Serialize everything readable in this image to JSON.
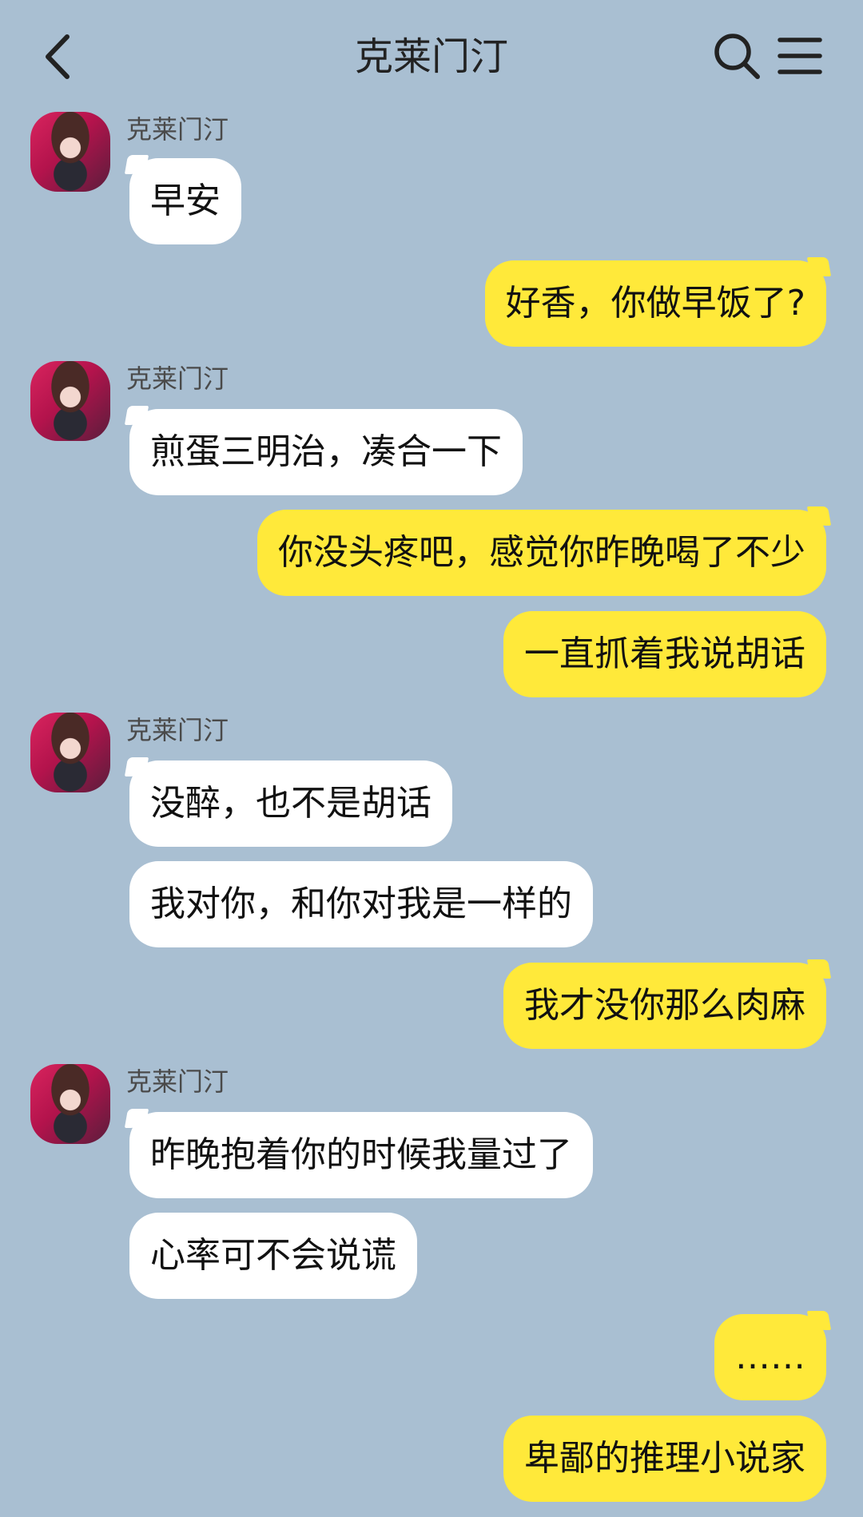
{
  "header": {
    "title": "克莱门汀"
  },
  "messages": [
    {
      "side": "left",
      "sender": "克莱门汀",
      "text": "早安"
    },
    {
      "side": "right",
      "text": "好香，你做早饭了?"
    },
    {
      "side": "left",
      "sender": "克莱门汀",
      "text": "煎蛋三明治，凑合一下"
    },
    {
      "side": "right",
      "text": "你没头疼吧，感觉你昨晚喝了不少"
    },
    {
      "side": "right",
      "text": "一直抓着我说胡话"
    },
    {
      "side": "left",
      "sender": "克莱门汀",
      "text": "没醉，也不是胡话"
    },
    {
      "side": "left",
      "text": "我对你，和你对我是一样的"
    },
    {
      "side": "right",
      "text": "我才没你那么肉麻"
    },
    {
      "side": "left",
      "sender": "克莱门汀",
      "text": "昨晚抱着你的时候我量过了"
    },
    {
      "side": "left",
      "text": "心率可不会说谎"
    },
    {
      "side": "right",
      "text": "……"
    },
    {
      "side": "right",
      "text": "卑鄙的推理小说家"
    }
  ],
  "colors": {
    "background": "#a9bfd2",
    "incoming_bubble": "#ffffff",
    "outgoing_bubble": "#ffe93a"
  },
  "icons": {
    "back": "chevron-left-icon",
    "search": "search-icon",
    "menu": "menu-icon"
  }
}
